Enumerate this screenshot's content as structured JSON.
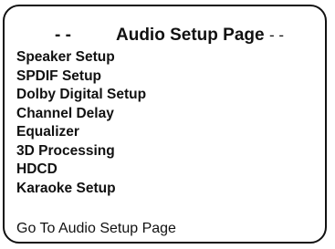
{
  "header": {
    "dash_left": "- -",
    "title": "Audio Setup Page",
    "dash_right": "- -"
  },
  "menu": {
    "items": [
      "Speaker Setup",
      "SPDIF Setup",
      "Dolby Digital Setup",
      "Channel Delay",
      "Equalizer",
      "3D Processing",
      "HDCD",
      "Karaoke Setup"
    ]
  },
  "footer": {
    "status": "Go To Audio Setup Page"
  }
}
